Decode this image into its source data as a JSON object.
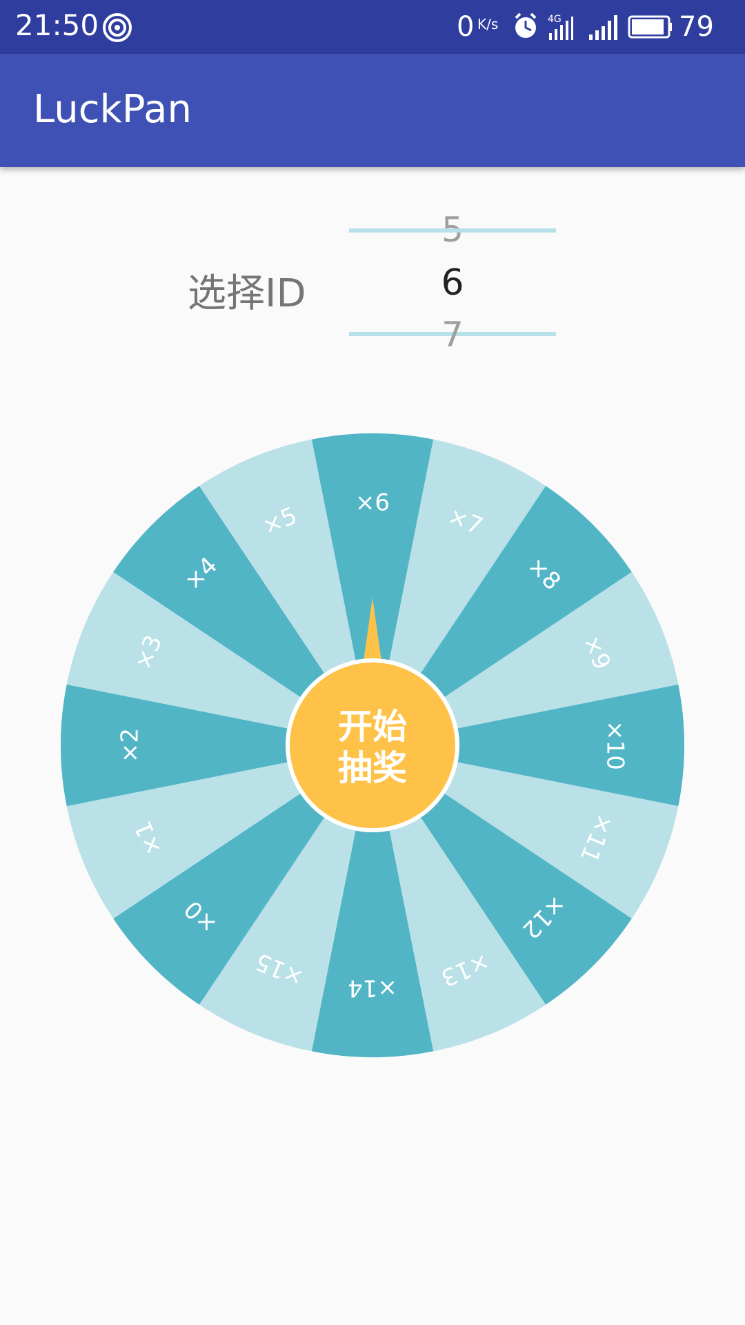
{
  "status_bar": {
    "time": "21:50",
    "speed": "0",
    "speed_unit": "K/s",
    "network": "4G",
    "battery": "79"
  },
  "app_bar": {
    "title": "LuckPan"
  },
  "picker": {
    "label": "选择ID",
    "prev": "5",
    "current": "6",
    "next": "7"
  },
  "wheel": {
    "segments": [
      "×6",
      "×7",
      "×8",
      "×9",
      "×10",
      "×11",
      "×12",
      "×13",
      "×14",
      "×15",
      "×0",
      "×1",
      "×2",
      "×3",
      "×4",
      "×5"
    ],
    "start_button_line1": "开始",
    "start_button_line2": "抽奖",
    "colors": {
      "dark": "#52b5c6",
      "light": "#b9e1e7",
      "button": "#ffc248",
      "pointer": "#ffc248"
    }
  }
}
